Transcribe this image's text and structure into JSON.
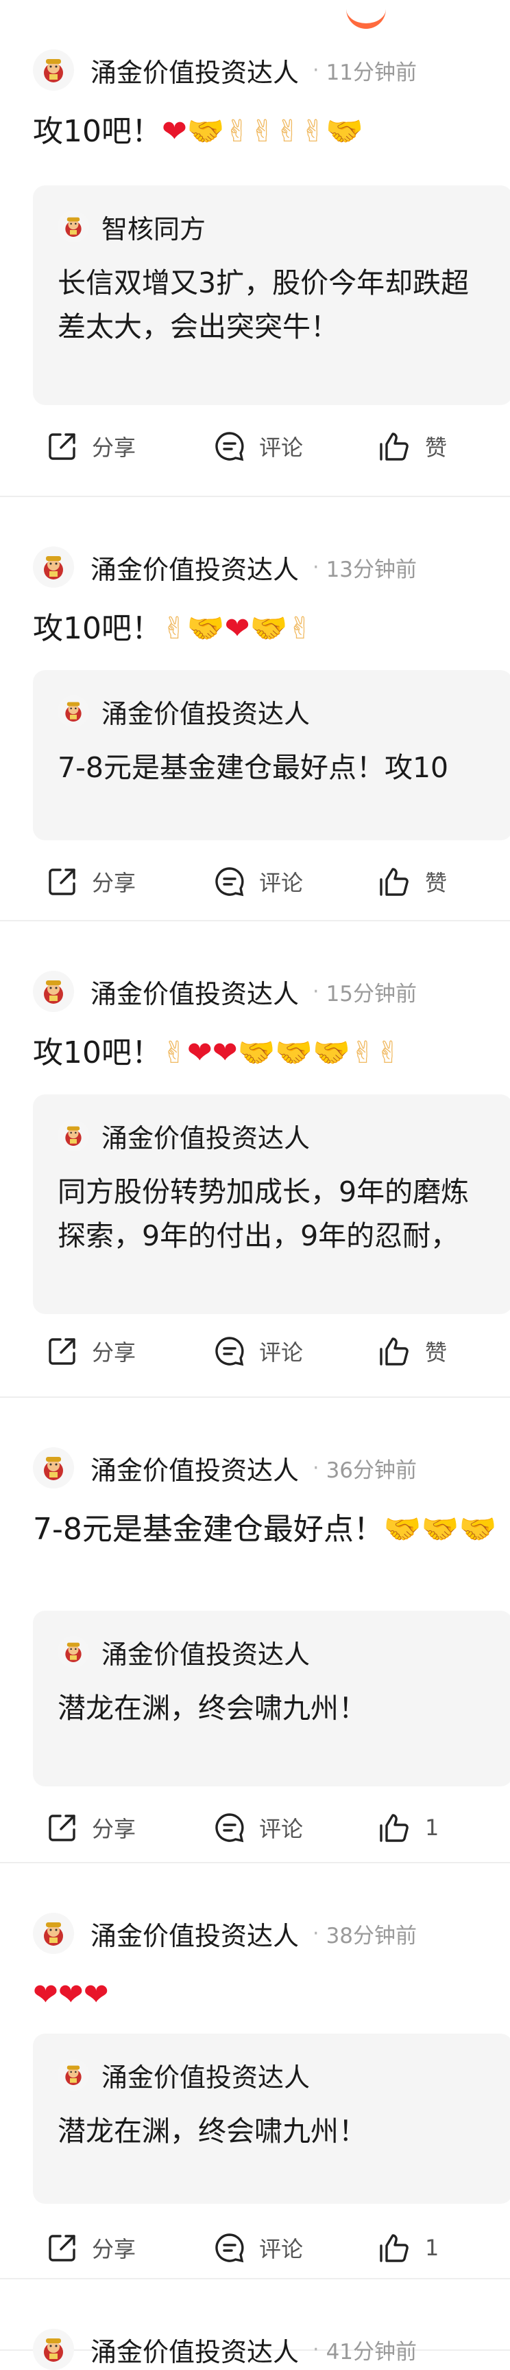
{
  "colors": {
    "heart": "#e8152a",
    "accent": "#ff6a3d",
    "card_bg": "#f5f5f5",
    "muted": "#9a9a9a"
  },
  "actions": {
    "share": "分享",
    "comment": "评论",
    "like": "赞"
  },
  "posts": [
    {
      "author": "涌金价值投资达人",
      "time": "11分钟前",
      "text": "攻10吧！",
      "emojis": [
        "heart",
        "handshake",
        "victory",
        "victory",
        "victory",
        "victory",
        "handshake"
      ],
      "quote": {
        "author": "智核同方",
        "text": "长信双增又3扩，股价今年却跌超\n差太大，会出突突牛！"
      },
      "likes": "赞"
    },
    {
      "author": "涌金价值投资达人",
      "time": "13分钟前",
      "text": "攻10吧！",
      "emojis": [
        "victory",
        "handshake",
        "heart",
        "handshake",
        "victory"
      ],
      "quote": {
        "author": "涌金价值投资达人",
        "text": "7-8元是基金建仓最好点！攻10"
      },
      "likes": "赞"
    },
    {
      "author": "涌金价值投资达人",
      "time": "15分钟前",
      "text": "攻10吧！",
      "emojis": [
        "victory",
        "heart",
        "heart",
        "handshake",
        "handshake",
        "handshake",
        "victory",
        "victory"
      ],
      "quote": {
        "author": "涌金价值投资达人",
        "text": "同方股份转势加成长，9年的磨炼\n探索，9年的付出，9年的忍耐，"
      },
      "likes": "赞"
    },
    {
      "author": "涌金价值投资达人",
      "time": "36分钟前",
      "text": "7-8元是基金建仓最好点！",
      "emojis": [
        "handshake",
        "handshake",
        "handshake"
      ],
      "quote": {
        "author": "涌金价值投资达人",
        "text": "潜龙在渊，终会啸九州！"
      },
      "likes": "1"
    },
    {
      "author": "涌金价值投资达人",
      "time": "38分钟前",
      "text": "",
      "emojis": [
        "heart",
        "heart",
        "heart"
      ],
      "quote": {
        "author": "涌金价值投资达人",
        "text": "潜龙在渊，终会啸九州！"
      },
      "likes": "1"
    },
    {
      "author": "涌金价值投资达人",
      "time": "41分钟前",
      "text": "",
      "emojis": [],
      "quote": null,
      "likes": ""
    }
  ]
}
